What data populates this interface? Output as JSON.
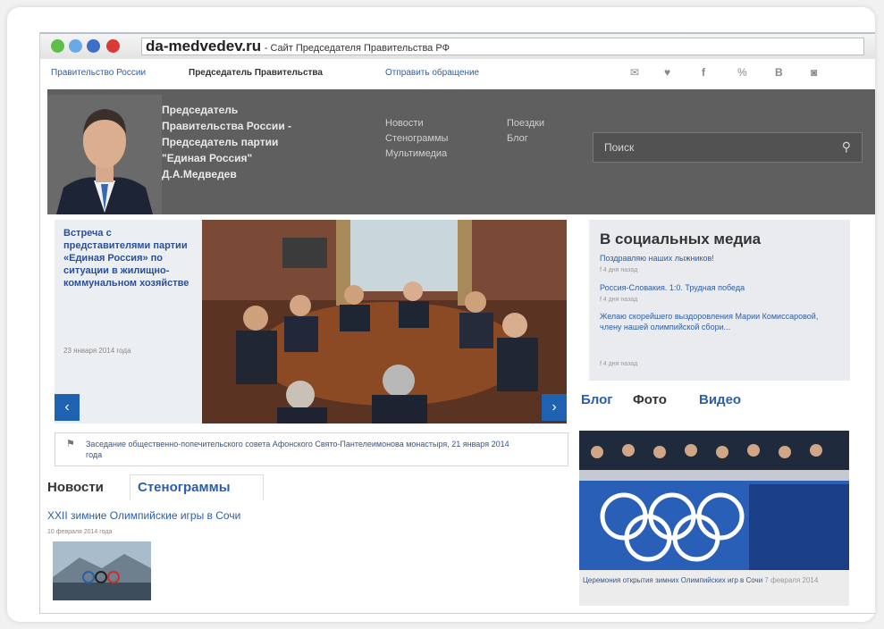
{
  "browser": {
    "domain": "da-medvedev.ru",
    "title": "- Сайт Председателя Правительства РФ"
  },
  "topnav": {
    "items": [
      "Правительство России",
      "Председатель Правительства",
      "Отправить обращение"
    ],
    "social_icons": [
      "mail-icon",
      "twitter-icon",
      "facebook-icon",
      "link-icon",
      "vk-icon",
      "instagram-icon"
    ]
  },
  "header": {
    "title_lines": [
      "Председатель",
      "Правительства России -",
      "Председатель партии",
      "\"Единая Россия\"",
      "Д.А.Медведев"
    ],
    "nav_col1": [
      "Новости",
      "Стенограммы",
      "Мультимедиа"
    ],
    "nav_col2": [
      "Поездки",
      "Блог"
    ],
    "search_placeholder": "Поиск"
  },
  "feature": {
    "headline": "Встреча с представителями партии «Единая Россия» по ситуации в жилищно-коммунальном хозяйстве",
    "date": "23 января 2014 года",
    "caption": "Заседание общественно-попечительского совета Афонского Свято-Пантелеимонова монастыря, 21 января 2014 года"
  },
  "news": {
    "tab_active": "Новости",
    "tab_inactive": "Стенограммы",
    "headline": "XXII зимние Олимпийские игры в Сочи",
    "date": "10 февраля 2014 года"
  },
  "social": {
    "title": "В социальных медиа",
    "items": [
      {
        "text": "Поздравляю наших лыжников!",
        "meta": "f  4 дня назад"
      },
      {
        "text": "Россия-Словакия. 1:0. Трудная победа",
        "meta": "f  4 дня назад"
      },
      {
        "text": "Желаю скорейшего выздоровления Марии Комиссаровой, члену нашей олимпийской сбори...",
        "meta": "f  4 дня назад"
      }
    ]
  },
  "media_tabs": {
    "blog": "Блог",
    "photo": "Фото",
    "video": "Видео"
  },
  "photo_caption": {
    "text": "Церемония открытия зимних Олимпийских игр в Сочи",
    "date": "7 февраля 2014"
  },
  "colors": {
    "header_bg": "#5f5f5f",
    "link": "#2c5ea8",
    "arrow": "#1f62b2"
  }
}
